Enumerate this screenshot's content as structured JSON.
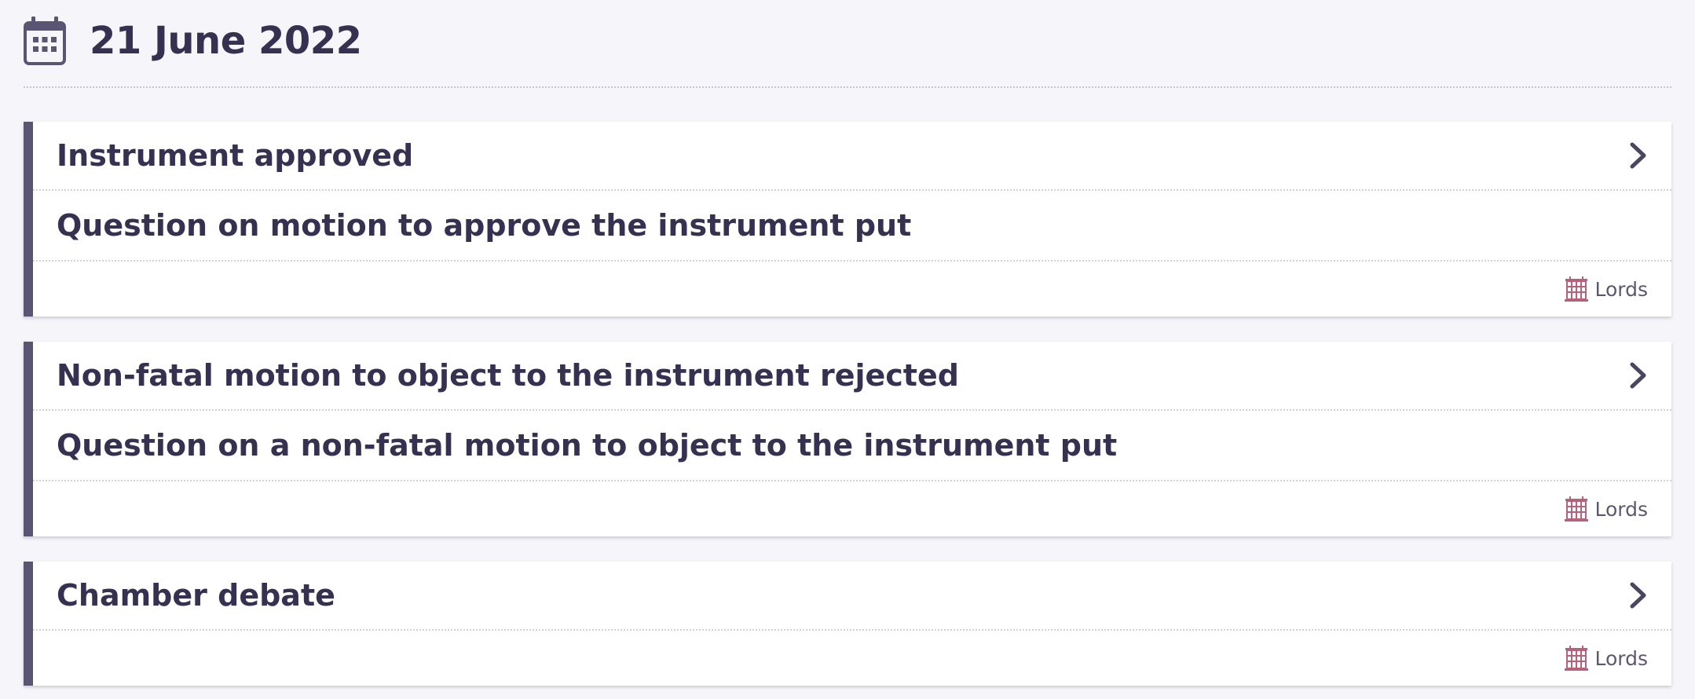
{
  "date_heading": "21 June 2022",
  "icons": {
    "calendar": "calendar-icon",
    "chevron": "chevron-right-icon",
    "house": "portcullis-icon"
  },
  "colors": {
    "accent_bar": "#5b5574",
    "text": "#373151",
    "lords_red": "#b50938",
    "background": "#f6f5fa"
  },
  "events": [
    {
      "title": "Instrument approved",
      "subtitle": "Question on motion to approve the instrument put",
      "house": "Lords"
    },
    {
      "title": "Non-fatal motion to object to the instrument rejected",
      "subtitle": "Question on a non-fatal motion to object to the instrument put",
      "house": "Lords"
    },
    {
      "title": "Chamber debate",
      "house": "Lords"
    }
  ]
}
